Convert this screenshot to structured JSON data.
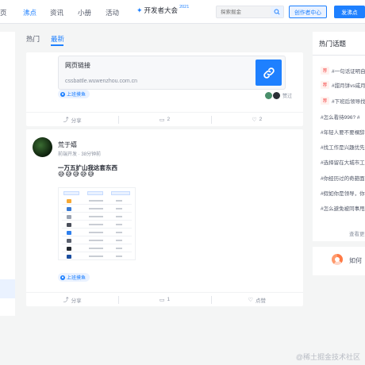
{
  "nav": {
    "items": [
      "页",
      "沸点",
      "资讯",
      "小册",
      "活动"
    ],
    "conference": "开发者大会",
    "conference_year": "2021",
    "search_placeholder": "探索掘金",
    "creator_center": "创作者中心",
    "publish": "发沸点"
  },
  "tabs": [
    "热门",
    "最新"
  ],
  "posts": [
    {
      "link_title": "网页链接",
      "link_url": "cssbattle.wuwenzhou.com.cn",
      "tag": "上班摸鱼",
      "liked_text": "赞过",
      "actions": {
        "share": "分享",
        "comments": "2",
        "likes": "2"
      }
    },
    {
      "author": "荒于嬉",
      "role": "前端开发",
      "time": "38分钟前",
      "content": "一万五扩山我这套东西",
      "emojis": "😅😅😅😅😅",
      "tag": "上班摸鱼",
      "actions": {
        "share": "分享",
        "comments": "1",
        "likes": "点赞"
      }
    }
  ],
  "hot_topics": {
    "title": "热门话题",
    "badge": "荐",
    "items": [
      "#一句话证明自",
      "#甜月饼vs咸月",
      "#下班后领导找",
      "#怎么看待996? #",
      "#年轻人要不要裸辞",
      "#找工作是兴趣优先",
      "#选择留在大城市工",
      "#你经历过的奇葩面",
      "#假如你是领导，你",
      "#怎么避免被同事甩"
    ],
    "more": "查看更"
  },
  "promo": {
    "text": "如何"
  },
  "watermark": "@稀土掘金技术社区",
  "colors": {
    "accent": "#1e80ff",
    "hot_badge": "#f53f3f"
  }
}
